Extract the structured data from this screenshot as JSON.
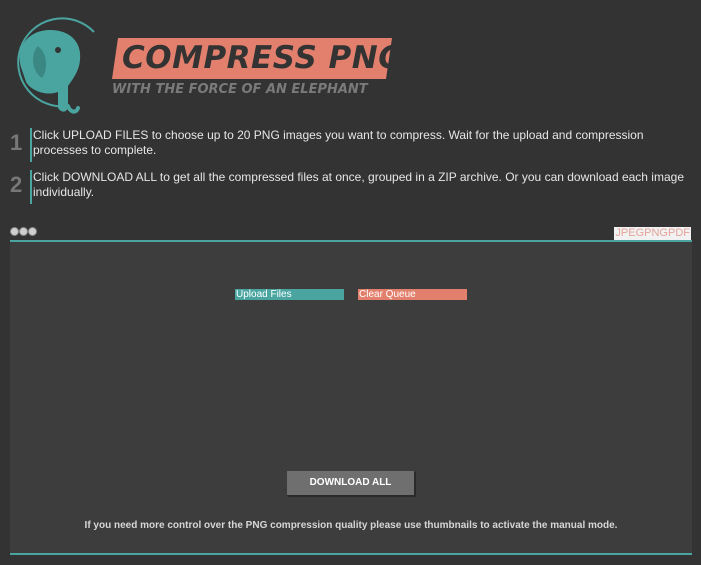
{
  "logo": {
    "title": "COMPRESS PNG",
    "tagline": "WITH THE FORCE OF AN ELEPHANT",
    "colors": {
      "teal": "#4aa5a1",
      "coral": "#e2806d"
    },
    "icon": "elephant-icon"
  },
  "steps": [
    {
      "number": "1",
      "text": "Click UPLOAD FILES to choose up to 20 PNG images you want to compress. Wait for the upload and compression processes to complete."
    },
    {
      "number": "2",
      "text": "Click DOWNLOAD ALL to get all the compressed files at once, grouped in a ZIP archive. Or you can download each image individually."
    }
  ],
  "format_tabs": [
    "JPEG",
    "PNG",
    "PDF"
  ],
  "uploader": {
    "upload_label": "Upload Files",
    "clear_label": "Clear Queue",
    "download_all_label": "DOWNLOAD ALL",
    "note": "If you need more control over the PNG compression quality please use thumbnails to activate the manual mode."
  }
}
